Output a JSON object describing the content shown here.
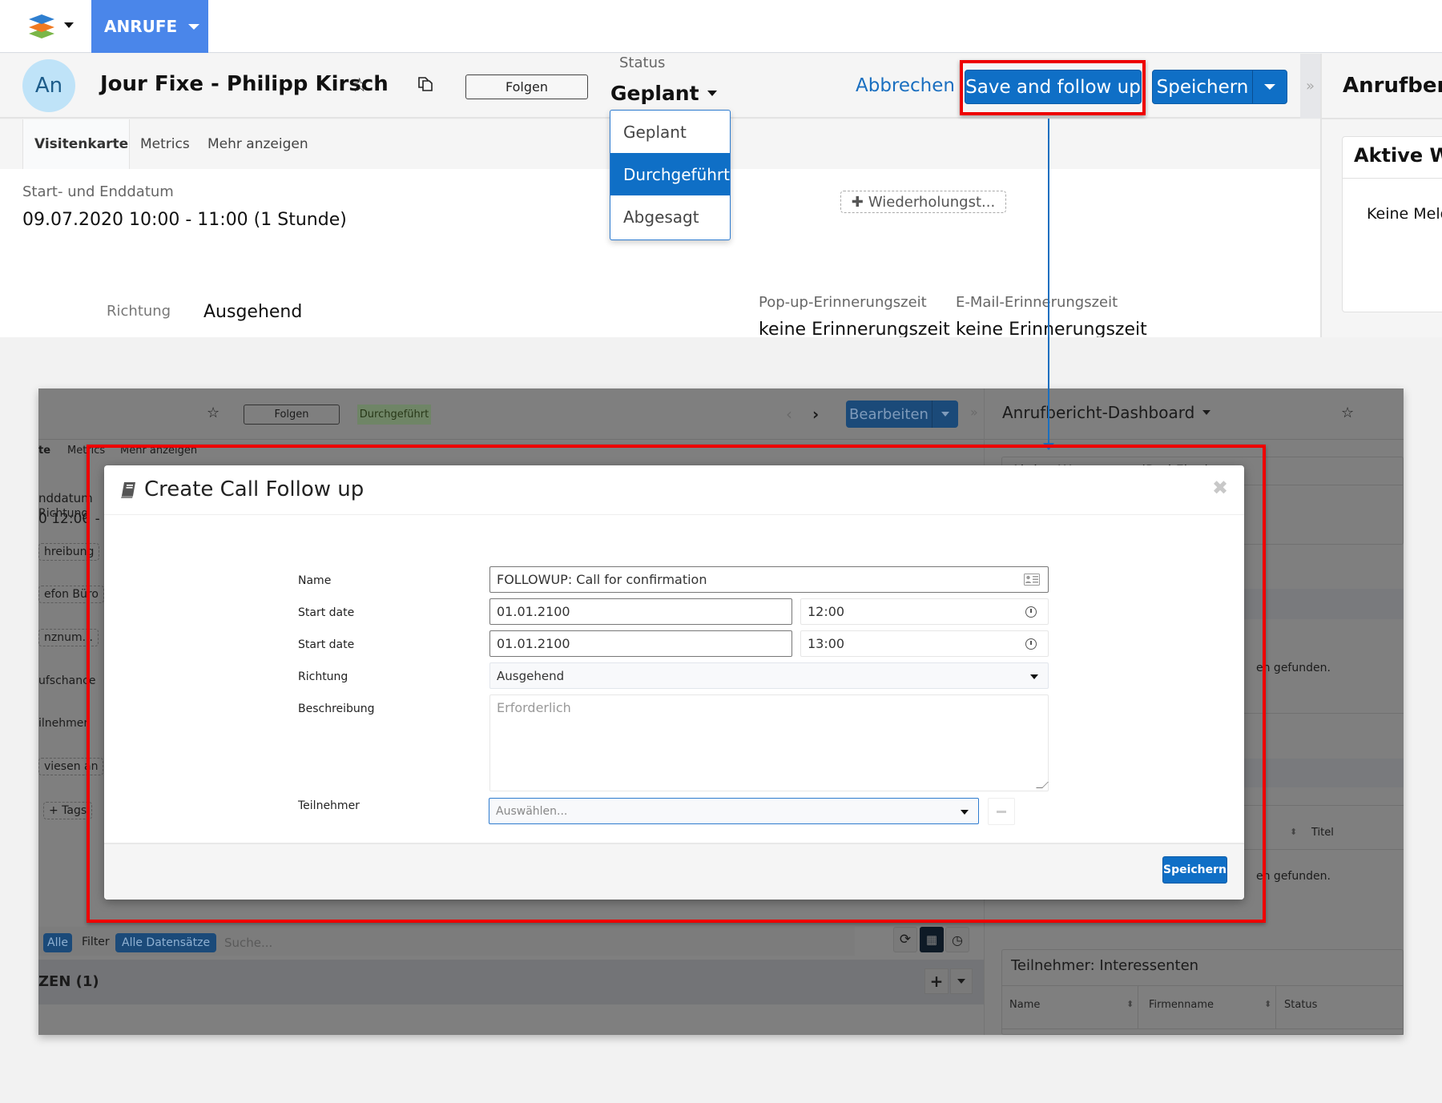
{
  "app": {
    "module_tab": "ANRUFE",
    "logo_icon": "stacked-layers-logo-icon"
  },
  "record": {
    "avatar_initials": "An",
    "title": "Jour Fixe - Philipp Kirsch",
    "favorite_icon": "star-icon",
    "copy_icon": "copy-icon",
    "follow_label": "Folgen",
    "status_label": "Status",
    "status_value": "Geplant",
    "status_options": [
      {
        "label": "Geplant",
        "selected": false
      },
      {
        "label": "Durchgeführt",
        "selected": true
      },
      {
        "label": "Abgesagt",
        "selected": false
      }
    ],
    "cancel_label": "Abbrechen",
    "save_follow_label": "Save and follow up",
    "save_label": "Speichern",
    "collapse_icon": "»"
  },
  "tabs": [
    {
      "label": "Visitenkarte",
      "active": true
    },
    {
      "label": "Metrics",
      "active": false
    },
    {
      "label": "Mehr anzeigen",
      "active": false
    }
  ],
  "details": {
    "date_label": "Start- und Enddatum",
    "date_value": "09.07.2020 10:00 - 11:00 (1 Stunde)",
    "repeat_label": "Wiederholungst...",
    "direction_label": "Richtung",
    "direction_value": "Ausgehend",
    "popup_label": "Pop-up-Erinnerungszeit",
    "popup_value": "keine Erinnerungszeit",
    "email_label": "E-Mail-Erinnerungszeit",
    "email_value": "keine Erinnerungszeit"
  },
  "right_panel": {
    "title": "Anrufbericht-Dashboard",
    "card_title": "Aktive Warnungen (Red Flag)",
    "card_text": "Keine Meldungen gefunden."
  },
  "background_screenshot": {
    "follow_label": "Folgen",
    "status_badge": "Durchgeführt",
    "edit_label": "Bearbeiten",
    "dashboard_title": "Anrufbericht-Dashboard",
    "tabs": [
      "te",
      "Metrics",
      "Mehr anzeigen"
    ],
    "date_label": "nddatum",
    "date_value": "0 12:00 - 1",
    "fields": [
      "Richtung",
      "hreibung",
      "efon Büro",
      "nznum...",
      "ufschance",
      "ilnehmer",
      "viesen an",
      "+ Tags"
    ],
    "filter_all": "Alle",
    "filter_label": "Filter",
    "filter_records": "Alle Datensätze",
    "search_placeholder": "Suche...",
    "section_title": "ZEN (1)",
    "warnings_title": "Aktive Warnungen (Red Flag)",
    "no_results_1": "en gefunden.",
    "no_results_2": "en gefunden.",
    "titel_col": "Titel",
    "participants_title": "Teilnehmer: Interessenten",
    "participants_columns": [
      "Name",
      "Firmenname",
      "Status"
    ]
  },
  "modal": {
    "title": "Create Call Follow up",
    "icon": "book-icon",
    "close_icon": "✖",
    "fields": {
      "name_label": "Name",
      "name_value": "FOLLOWUP: Call for confirmation",
      "start_label": "Start date",
      "start_date": "01.01.2100",
      "start_time": "12:00",
      "end_label": "Start date",
      "end_date": "01.01.2100",
      "end_time": "13:00",
      "direction_label": "Richtung",
      "direction_value": "Ausgehend",
      "description_label": "Beschreibung",
      "description_placeholder": "Erforderlich",
      "participants_label": "Teilnehmer",
      "participants_placeholder": "Auswählen..."
    },
    "save_label": "Speichern"
  },
  "annotations": {
    "highlight_color": "#e00000",
    "connector_color": "#1a6fc0"
  }
}
